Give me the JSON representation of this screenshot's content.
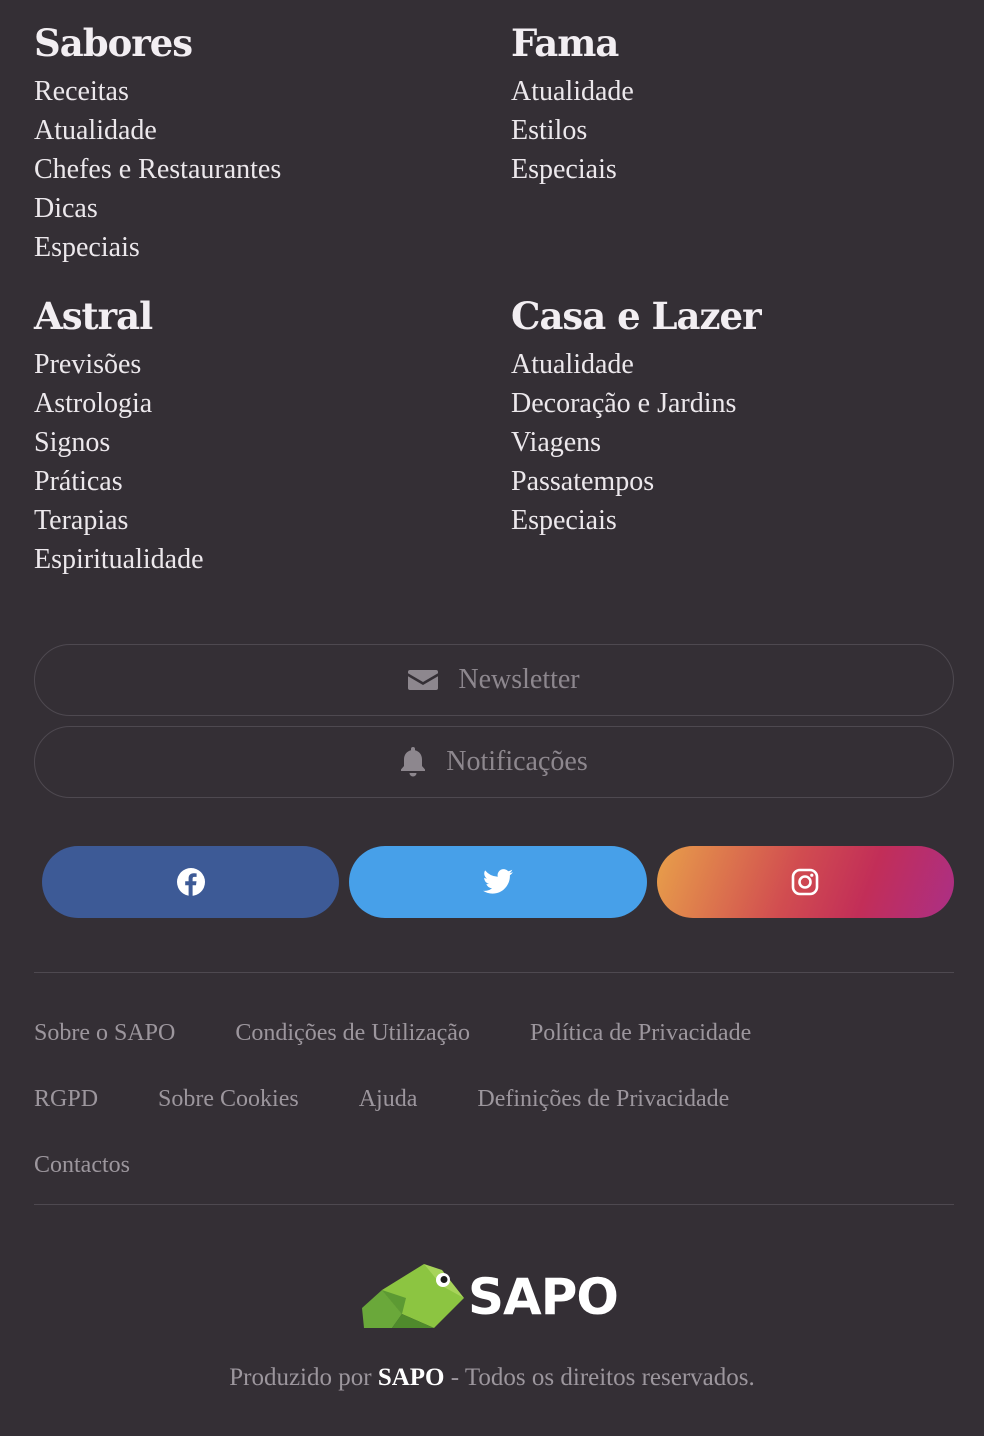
{
  "sections": [
    {
      "title": "Sabores",
      "items": [
        "Receitas",
        "Atualidade",
        "Chefes e Restaurantes",
        "Dicas",
        "Especiais"
      ]
    },
    {
      "title": "Fama",
      "items": [
        "Atualidade",
        "Estilos",
        "Especiais"
      ]
    },
    {
      "title": "Astral",
      "items": [
        "Previsões",
        "Astrologia",
        "Signos",
        "Práticas",
        "Terapias",
        "Espiritualidade"
      ]
    },
    {
      "title": "Casa e Lazer",
      "items": [
        "Atualidade",
        "Decoração e Jardins",
        "Viagens",
        "Passatempos",
        "Especiais"
      ]
    }
  ],
  "buttons": {
    "newsletter_label": "Newsletter",
    "notifications_label": "Notificações"
  },
  "social": [
    {
      "name": "facebook-icon",
      "color": "#3d5a96"
    },
    {
      "name": "twitter-icon",
      "color": "#47a0e9"
    },
    {
      "name": "instagram-icon",
      "color": "#c93a5a"
    }
  ],
  "footer_links": {
    "row1": [
      "Sobre o SAPO",
      "Condições de Utilização",
      "Política de Privacidade"
    ],
    "row2": [
      "RGPD",
      "Sobre Cookies",
      "Ajuda",
      "Definições de Privacidade"
    ],
    "row3": [
      "Contactos"
    ]
  },
  "logo": {
    "text": "SAPO"
  },
  "credits": {
    "prefix": "Produzido por ",
    "brand": "SAPO",
    "suffix": " - Todos os direitos reservados."
  }
}
